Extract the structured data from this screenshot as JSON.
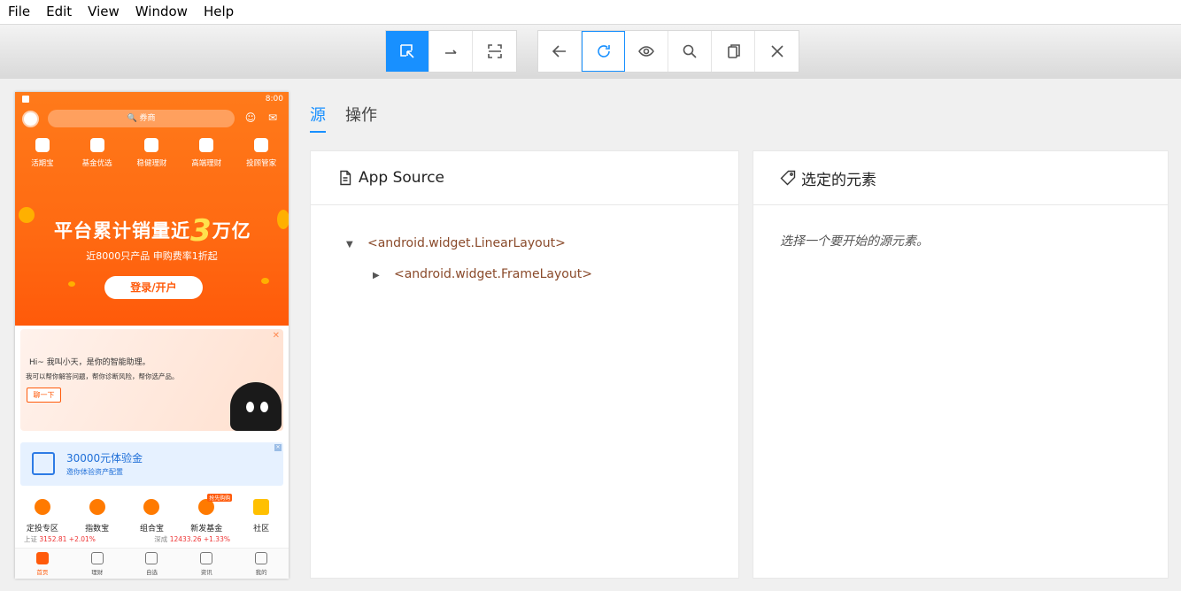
{
  "menu": [
    "File",
    "Edit",
    "View",
    "Window",
    "Help"
  ],
  "toolbar": {
    "group1": [
      {
        "icon": "select-element-icon",
        "active": true
      },
      {
        "icon": "swipe-icon",
        "active": false
      },
      {
        "icon": "tap-region-icon",
        "active": false
      }
    ],
    "group2": [
      {
        "icon": "back-arrow-icon"
      },
      {
        "icon": "refresh-icon"
      },
      {
        "icon": "eye-icon"
      },
      {
        "icon": "search-icon"
      },
      {
        "icon": "copy-icon"
      },
      {
        "icon": "close-icon"
      }
    ]
  },
  "phone": {
    "status_time": "8:00",
    "search_placeholder": "🔍 券商",
    "nav": [
      "活期宝",
      "基金优选",
      "稳健理财",
      "高端理财",
      "投顾管家"
    ],
    "banner": {
      "title_pre": "平台累计销量近",
      "title_num": "3",
      "title_post": "万亿",
      "subtitle": "近8000只产品 申购费率1折起",
      "login": "登录/开户"
    },
    "assistant": {
      "line1": "Hi~ 我叫小天，是你的智能助理。",
      "line2": "我可以帮你解答问题，帮你诊断风险，帮你选产品。",
      "button": "聊一下"
    },
    "gold": {
      "title": "30000元体验金",
      "subtitle": "邀你体验资产配置"
    },
    "grid": [
      "定投专区",
      "指数宝",
      "组合宝",
      "新发基金",
      "社区"
    ],
    "grid_badge": "抢先购购",
    "ticker": {
      "sh_label": "上证",
      "sh_value": "3152.81 +2.01%",
      "sz_label": "深成",
      "sz_value": "12433.26 +1.33%"
    },
    "tabbar": [
      "首页",
      "理财",
      "自选",
      "资讯",
      "我的"
    ]
  },
  "tabs": [
    "源",
    "操作"
  ],
  "source_panel": {
    "title": "App Source",
    "nodes": [
      {
        "label": "<android.widget.LinearLayout>",
        "expanded": true
      },
      {
        "label": "<android.widget.FrameLayout>",
        "expanded": false
      }
    ]
  },
  "selected_panel": {
    "title": "选定的元素",
    "hint": "选择一个要开始的源元素。"
  },
  "colors": {
    "accent": "#1890ff",
    "brand_orange": "#ff6a12"
  }
}
